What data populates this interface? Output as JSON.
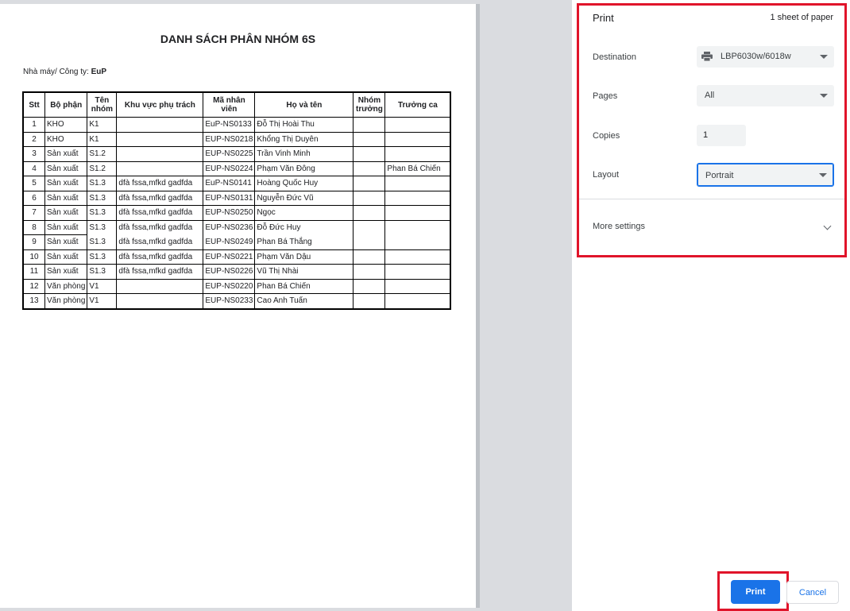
{
  "document": {
    "title": "DANH SÁCH PHÂN NHÓM 6S",
    "company_label": "Nhà máy/ Công ty:",
    "company_value": "EuP",
    "table": {
      "headers": [
        "Stt",
        "Bộ phận",
        "Tên nhóm",
        "Khu vực phụ trách",
        "Mã nhân viên",
        "Họ và tên",
        "Nhóm trưởng",
        "Trưởng ca"
      ],
      "rows": [
        [
          "1",
          "KHO",
          "K1",
          "",
          "EuP-NS0133",
          "Đỗ Thị Hoài Thu",
          "",
          ""
        ],
        [
          "2",
          "KHO",
          "K1",
          "",
          "EUP-NS0218",
          "Khổng Thị Duyên",
          "",
          ""
        ],
        [
          "3",
          "Sản xuất",
          "S1.2",
          "",
          "EUP-NS0225",
          "Trần Vinh Minh",
          "",
          ""
        ],
        [
          "4",
          "Sản xuất",
          "S1.2",
          "",
          "EUP-NS0224",
          "Phạm Văn Đông",
          "",
          "Phan Bá Chiến"
        ],
        [
          "5",
          "Sản xuất",
          "S1.3",
          "dfà fssa,mfkd gadfda",
          "EuP-NS0141",
          "Hoàng Quốc Huy",
          "",
          ""
        ],
        [
          "6",
          "Sản xuất",
          "S1.3",
          "dfà fssa,mfkd gadfda",
          "EUP-NS0131",
          "Nguyễn Đức Vũ",
          "",
          ""
        ],
        [
          "7",
          "Sản xuất",
          "S1.3",
          "dfà fssa,mfkd gadfda",
          "EUP-NS0250",
          "Ngọc",
          "",
          ""
        ],
        [
          "8",
          "Sản xuất",
          "S1.3",
          "dfà fssa,mfkd gadfda",
          "EUP-NS0236",
          "Đỗ Đức Huy",
          "",
          ""
        ],
        [
          "9",
          "Sản xuất",
          "S1.3",
          "dfà fssa,mfkd gadfda",
          "EUP-NS0249",
          "Phan Bá Thắng",
          "",
          ""
        ],
        [
          "10",
          "Sản xuất",
          "S1.3",
          "dfà fssa,mfkd gadfda",
          "EUP-NS0221",
          "Phạm Văn Dậu",
          "",
          ""
        ],
        [
          "11",
          "Sản xuất",
          "S1.3",
          "dfà fssa,mfkd gadfda",
          "EUP-NS0226",
          "Vũ Thị Nhài",
          "",
          ""
        ],
        [
          "12",
          "Văn phòng",
          "V1",
          "",
          "EUP-NS0220",
          "Phan Bá Chiến",
          "",
          ""
        ],
        [
          "13",
          "Văn phòng",
          "V1",
          "",
          "EUP-NS0233",
          "Cao Anh Tuấn",
          "",
          ""
        ]
      ]
    }
  },
  "print_panel": {
    "heading": "Print",
    "sheet_count": "1 sheet of paper",
    "destination_label": "Destination",
    "destination_value": "LBP6030w/6018w",
    "pages_label": "Pages",
    "pages_value": "All",
    "copies_label": "Copies",
    "copies_value": "1",
    "layout_label": "Layout",
    "layout_value": "Portrait",
    "more_settings_label": "More settings",
    "print_button": "Print",
    "cancel_button": "Cancel",
    "icons": [
      "printer-icon",
      "chevron-down-icon"
    ],
    "colors": {
      "accent": "#1a73e8",
      "highlight_box": "#e0142a"
    }
  }
}
